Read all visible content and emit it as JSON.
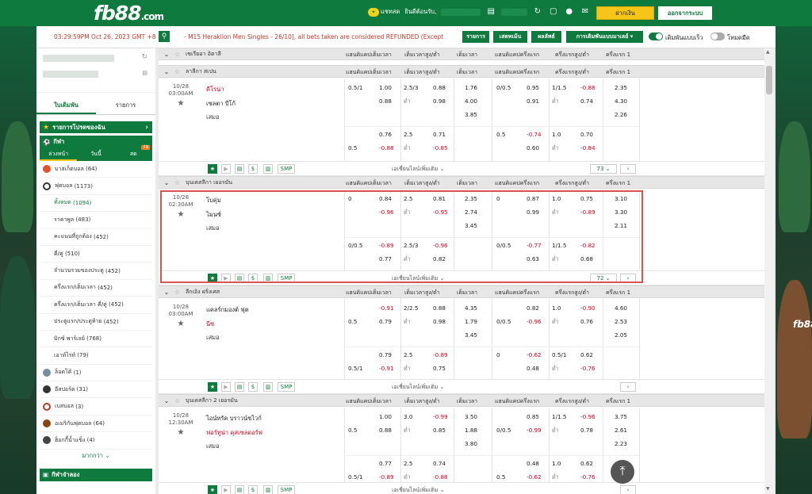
{
  "header": {
    "brand": "fb88",
    "brand_suffix": ".com",
    "chat_label": "แชทสด",
    "welcome": "ยินดีต้อนรับ,",
    "username": "●●●●●●●",
    "balance": "●●.●●",
    "deposit": "ฝากเงิน",
    "logout": "ออกจากระบบ"
  },
  "toolbar": {
    "time": "03:29:59PM Oct 26, 2023 GMT +8",
    "marquee": "- M15 Heraklion Men Singles - 26/10], all bets taken are considered REFUNDED (Except Set",
    "btn_list": "รายการ",
    "btn_statement": "เสตทเม้น",
    "btn_results": "ผลลัพธ์",
    "btn_settings": "การเดิมพันแบบมาเลย์ ▾",
    "toggle_fast": "เดิมพันแบบเร็ว",
    "toggle_dark": "โหมดมืด"
  },
  "sidebar": {
    "tab_bets": "ใบเดิมพัน",
    "tab_list": "รายการ",
    "fav": "รายการโปรดของฉัน",
    "sports": "กีฬา",
    "sub_early": "ล่วงหน้า",
    "sub_today": "วันนี้",
    "sub_live": "สด",
    "live_count": "79",
    "items": [
      {
        "label": "บาสเก็ตบอล",
        "count": "(64)",
        "color": "#e8502a"
      },
      {
        "label": "ฟุตบอล",
        "count": "(1173)",
        "color": "#333333"
      }
    ],
    "football_sub": [
      {
        "label": "ทั้งหมด",
        "count": "(1094)"
      },
      {
        "label": "ราคาพูล",
        "count": "(483)"
      },
      {
        "label": "คะแนนที่ถูกต้อง",
        "count": "(452)"
      },
      {
        "label": "คี่/คู่",
        "count": "(510)"
      },
      {
        "label": "จำนวนรวมของประตู",
        "count": "(452)"
      },
      {
        "label": "ครึ่งแรก/เต็มเวลา",
        "count": "(452)"
      },
      {
        "label": "ครึ่งแรก/เต็มเวลา คี่/คู่",
        "count": "(452)"
      },
      {
        "label": "ประตูแรก/ประตูท้าย",
        "count": "(452)"
      },
      {
        "label": "มิกซ์ พาร์เลย์",
        "count": "(768)"
      },
      {
        "label": "เอาท์ไรท์",
        "count": "(79)"
      }
    ],
    "others": [
      {
        "label": "ล็อตโต้",
        "count": "(1)",
        "color": "#7a8d9a"
      },
      {
        "label": "อีสปอร์ต",
        "count": "(31)",
        "color": "#333333"
      },
      {
        "label": "เบสบอล",
        "count": "(3)",
        "color": "#c0392b"
      },
      {
        "label": "อเมริกันฟุตบอล",
        "count": "(64)",
        "color": "#8b4513"
      },
      {
        "label": "ฮ็อกกี้น้ำแข็ง",
        "count": "(4)",
        "color": "#444444"
      }
    ],
    "more": "มากกว่า",
    "virtual": "กีฬาจำลอง"
  },
  "columns": {
    "hdp": "แฮนดิแคปเต็มเวลา",
    "ou": "เต็มเวลาสูง/ต่ำ",
    "x12": "เต็มเวลา",
    "hhdp": "แฮนดิแคปครึ่งแรก",
    "hou": "ครึ่งแรกสูง/ต่ำ",
    "hx12": "ครึ่งแรก 1"
  },
  "common": {
    "draw": "เสมอ",
    "low": "ต่ำ",
    "more_lines": "เอเชี่ยนไลน์เพิ่มเติม",
    "smp": "SMP"
  },
  "leagues": [
    {
      "name": "ลาลีกา สเปน",
      "date": "10/28",
      "time": "03:00AM",
      "home": "คีโรน่า",
      "home_red": true,
      "away": "เซลตา บีโก้",
      "away_red": false,
      "count": "73",
      "r1": {
        "hdp": "0.5/1",
        "h1": "1.00",
        "h2": "0.88",
        "ou": "2.5/3",
        "o1": "0.88",
        "o2": "0.98",
        "x1": "1.76",
        "x2": "4.00",
        "x3": "3.85",
        "hh": "0/0.5",
        "hh1": "0.95",
        "hh2": "0.91",
        "hou": "1/1.5",
        "ho1": "-0.88",
        "ho2": "0.74",
        "hx1": "2.35",
        "hx2": "4.30",
        "hx3": "2.26"
      },
      "r2": {
        "hdp_a": "0.5",
        "h1": "0.76",
        "h2": "-0.88",
        "ou": "2.5",
        "o1": "0.71",
        "o2": "-0.85",
        "hh": "0.5",
        "hh1": "-0.74",
        "hh2": "0.60",
        "hou": "1.0",
        "ho1": "0.70",
        "ho2": "-0.84"
      }
    },
    {
      "name": "บุนเดสลีกา เยอรมัน",
      "date": "10/28",
      "time": "02:30AM",
      "home": "โบคุ่ม",
      "home_red": false,
      "away": "ไมนซ์",
      "away_red": false,
      "count": "72",
      "r1": {
        "hdp": "0",
        "h1": "0.84",
        "h2": "-0.96",
        "ou": "2.5",
        "o1": "0.81",
        "o2": "-0.95",
        "x1": "2.35",
        "x2": "2.74",
        "x3": "3.45",
        "hh": "0",
        "hh1": "0.87",
        "hh2": "0.99",
        "hou": "1.0",
        "ho1": "0.75",
        "ho2": "-0.89",
        "hx1": "3.10",
        "hx2": "3.30",
        "hx3": "2.11"
      },
      "r2": {
        "hdp": "0/0.5",
        "h1": "-0.89",
        "h2": "0.77",
        "ou": "2.5/3",
        "o1": "-0.96",
        "o2": "0.82",
        "hh": "0/0.5",
        "hh1": "-0.77",
        "hh2": "0.63",
        "hou": "1/1.5",
        "ho1": "-0.82",
        "ho2": "0.68"
      }
    },
    {
      "name": "ลีกเอิง ฝรั่งเศส",
      "date": "10/28",
      "time": "03:00AM",
      "home": "แคลร์กมองต์ ฟุต",
      "home_red": false,
      "away": "นีซ",
      "away_red": true,
      "count": "",
      "r1": {
        "h1": "-0.91",
        "hdp_a": "0.5",
        "h2": "0.79",
        "ou": "2/2.5",
        "o1": "0.88",
        "o2": "0.98",
        "x1": "4.35",
        "x2": "1.79",
        "x3": "3.45",
        "hh1": "0.82",
        "hh_a": "0/0.5",
        "hh2": "-0.96",
        "hou": "1.0",
        "ho1": "-0.90",
        "ho2": "0.76",
        "hx1": "4.60",
        "hx2": "2.53",
        "hx3": "2.05"
      },
      "r2": {
        "h1": "0.79",
        "hdp_a": "0.5/1",
        "h2": "-0.91",
        "ou": "2.5",
        "o1": "-0.89",
        "o2": "0.75",
        "hh": "0",
        "hh1": "-0.62",
        "hh2": "0.48",
        "hou": "0.5/1",
        "ho1": "0.62",
        "ho2": "-0.76"
      }
    },
    {
      "name": "บุนเดสลีกา 2 เยอรมัน",
      "date": "10/28",
      "time": "12:30AM",
      "home": "ไอน์ทรัค บราวน์ชไวก์",
      "home_red": false,
      "away": "ฟอร์ทูน่า ดุสเซลดอร์ฟ",
      "away_red": true,
      "count": "",
      "r1": {
        "h1": "1.00",
        "hdp_a": "0.5",
        "h2": "0.88",
        "ou": "3.0",
        "o1": "-0.99",
        "o2": "0.85",
        "x1": "3.50",
        "x2": "1.88",
        "x3": "3.80",
        "hh1": "0.85",
        "hh_a": "0/0.5",
        "hh2": "-0.99",
        "hou": "1/1.5",
        "ho1": "-0.96",
        "ho2": "0.78",
        "hx1": "3.75",
        "hx2": "2.61",
        "hx3": "2.23"
      },
      "r2": {
        "h1": "0.77",
        "hdp_a": "0.5/1",
        "h2": "-0.89",
        "ou": "2.5",
        "o1": "0.74",
        "o2": "-0.88",
        "hh1": "0.48",
        "hh_a": "0.5",
        "hh2": "-0.62",
        "hou": "1.0",
        "ho1": "0.62",
        "ho2": "-0.76"
      }
    }
  ],
  "top_league": {
    "name": "เซเรียอา อิตาลี"
  },
  "colors": {
    "brand": "#0f7a3d",
    "accent": "#f5c518",
    "red": "#d0021b",
    "highlight": "#d9534f"
  }
}
